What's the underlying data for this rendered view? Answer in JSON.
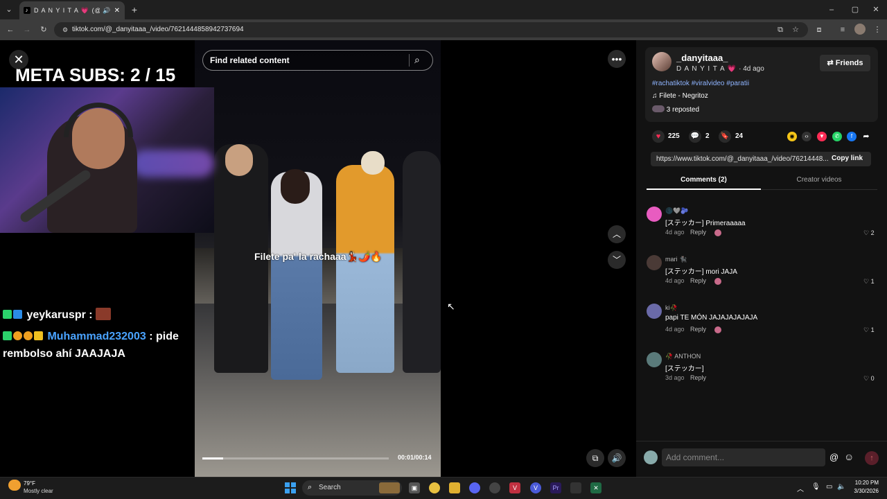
{
  "browser": {
    "tab_title": "D A N Y I T A 💗 (@_danyitaaa_)",
    "url": "tiktok.com/@_danyitaaa_/video/7621444858942737694"
  },
  "overlay": {
    "meta_subs": "META SUBS: 2 / 15",
    "chat": [
      {
        "user": "yeykaruspr",
        "sep": " :",
        "message": "",
        "color": "#ffffff"
      },
      {
        "user": "Muhammad232003",
        "sep": " :",
        "message": " pide rembolso ahí JAAJAJA",
        "color": "#4aa3ff"
      }
    ]
  },
  "video": {
    "search_placeholder": "Find related content",
    "caption": "Filete pa' la rachaaa💃🏻🌶️🔥",
    "time": "00:01/00:14",
    "progress": 0.11
  },
  "post": {
    "username": "_danyitaaa_",
    "display_name": "D A N Y I T A 💗",
    "age": "· 4d ago",
    "friends_label": "Friends",
    "hashtags": "#rachatiktok #viralvideo #paratii",
    "music": "Filete - Negritoz",
    "reposted": "3 reposted",
    "likes": "225",
    "comments_count": "2",
    "saves": "24",
    "link": "https://www.tiktok.com/@_danyitaaa_/video/76214448...",
    "copy_link": "Copy link",
    "tab_comments": "Comments (2)",
    "tab_creator": "Creator videos"
  },
  "comments": [
    {
      "user": "🌑🩶🫐",
      "text": "[ステッカー] Primeraaaaa",
      "age": "4d ago",
      "reply": "Reply",
      "likes": "2",
      "avatar_color": "#e85cc0"
    },
    {
      "user": "mari 🐈‍⬛",
      "text": "[ステッカー] mori JAJA",
      "age": "4d ago",
      "reply": "Reply",
      "likes": "1",
      "avatar_color": "#4a3a36"
    },
    {
      "user": "ki🥀",
      "text": "papi TE MÓN JAJAJAJAJAJA",
      "age": "4d ago",
      "reply": "Reply",
      "likes": "1",
      "avatar_color": "#6a6aa8"
    },
    {
      "user": "🥀 ANTHON",
      "text": "[ステッカー]",
      "age": "3d ago",
      "reply": "Reply",
      "likes": "0",
      "avatar_color": "#5a7a7a"
    }
  ],
  "add_comment_placeholder": "Add comment...",
  "taskbar": {
    "temp": "79°F",
    "weather": "Mostly clear",
    "search": "Search",
    "time": "10:20 PM",
    "date": "3/30/2026"
  }
}
